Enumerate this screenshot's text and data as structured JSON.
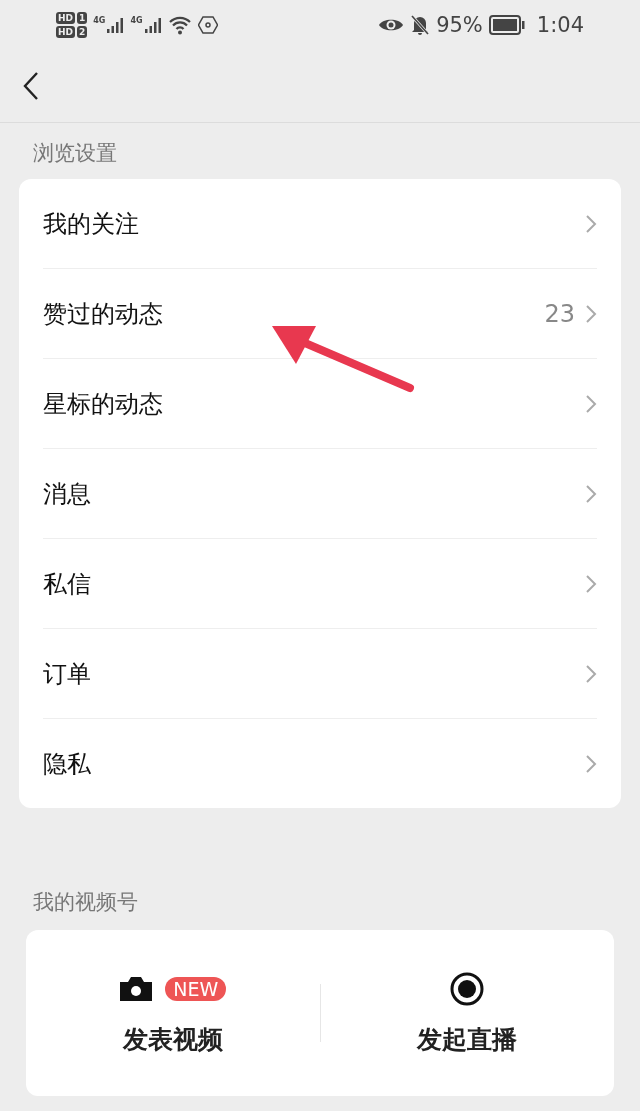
{
  "status_bar": {
    "sim_badges": [
      {
        "label": "HD",
        "slot": "1"
      },
      {
        "label": "HD",
        "slot": "2"
      }
    ],
    "networks": [
      "4G",
      "4G"
    ],
    "battery": "95%",
    "time": "1:04"
  },
  "sections": [
    {
      "title": "浏览设置",
      "items": [
        {
          "label": "我的关注"
        },
        {
          "label": "赞过的动态",
          "count": "23"
        },
        {
          "label": "星标的动态"
        },
        {
          "label": "消息"
        },
        {
          "label": "私信"
        },
        {
          "label": "订单"
        },
        {
          "label": "隐私"
        }
      ]
    }
  ],
  "channels": {
    "title": "我的视频号",
    "actions": [
      {
        "kind": "camera",
        "label": "发表视频",
        "badge": "NEW"
      },
      {
        "kind": "live",
        "label": "发起直播"
      }
    ]
  },
  "annotation": {
    "kind": "arrow",
    "color": "#e8384f"
  }
}
